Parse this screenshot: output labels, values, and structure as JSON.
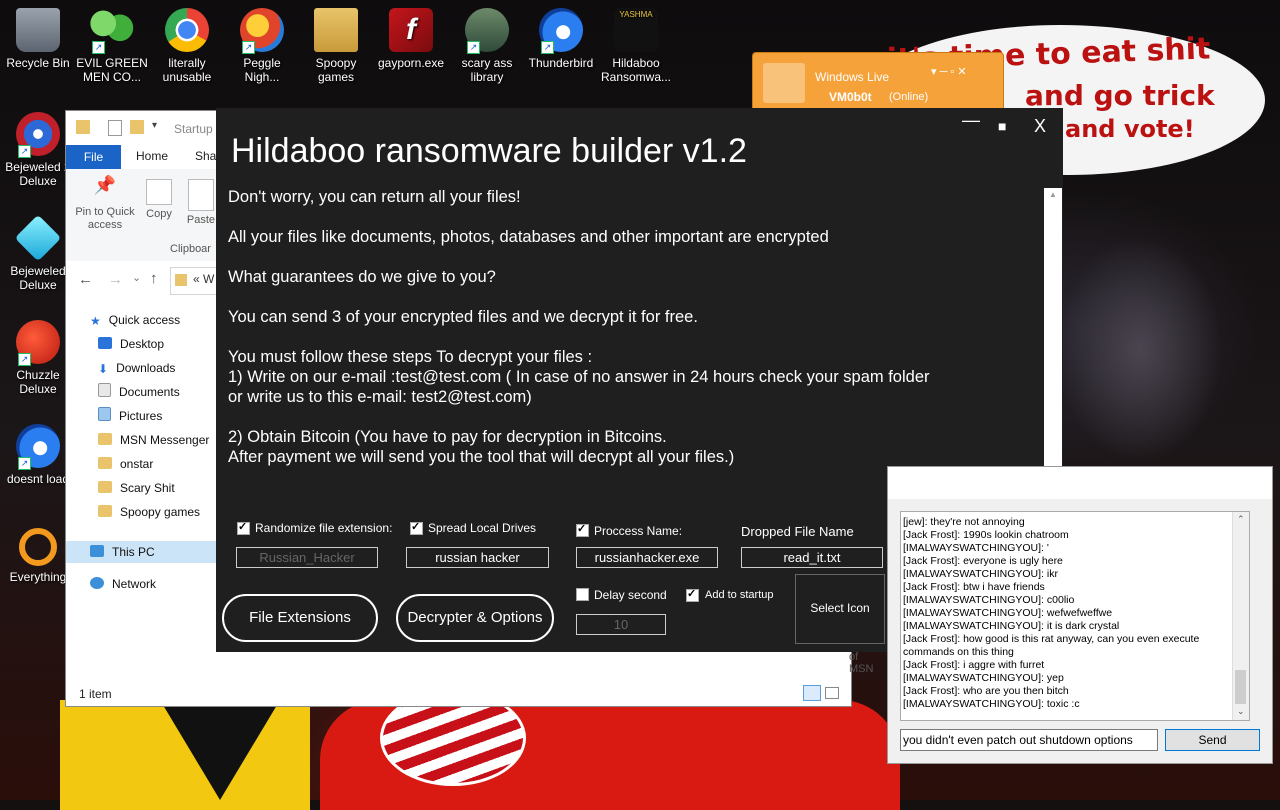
{
  "desktop": {
    "wallpaper_text": [
      "it's time to eat shit",
      "and go trick",
      "and vote!"
    ],
    "icons": [
      {
        "label": "Recycle Bin",
        "icon": "recycle-bin-icon"
      },
      {
        "label": "EVIL GREEN MEN CO...",
        "icon": "msn-people-icon"
      },
      {
        "label": "literally unusable",
        "icon": "chrome-icon"
      },
      {
        "label": "Peggle Nigh...",
        "icon": "peggle-icon"
      },
      {
        "label": "Spoopy games",
        "icon": "folder-icon"
      },
      {
        "label": "gayporn.exe",
        "icon": "flash-icon"
      },
      {
        "label": "scary ass library",
        "icon": "library-icon"
      },
      {
        "label": "Thunderbird",
        "icon": "thunderbird-icon"
      },
      {
        "label": "Hildaboo Ransomwa...",
        "icon": "yashma-icon"
      },
      {
        "label": "Bejeweled 2 Deluxe",
        "icon": "bejeweled2-icon"
      },
      {
        "label": "Bejeweled Deluxe",
        "icon": "bejeweled-icon"
      },
      {
        "label": "Chuzzle Deluxe",
        "icon": "chuzzle-icon"
      },
      {
        "label": "doesnt load",
        "icon": "thunderbird-icon"
      },
      {
        "label": "Everything",
        "icon": "everything-icon"
      }
    ],
    "icon_line2": [
      "",
      "MEN CO...",
      "unusable",
      "Nigh...",
      "games",
      "",
      "library",
      "",
      "Ransomwa...",
      "Deluxe",
      "Deluxe",
      "Deluxe",
      "",
      ""
    ],
    "icon_line1": [
      "Recycle Bin",
      "EVIL GREEN",
      "literally",
      "Peggle",
      "Spoopy",
      "gayporn.exe",
      "scary ass",
      "Thunderbird",
      "Hildaboo",
      "Bejeweled 2",
      "Bejeweled",
      "Chuzzle",
      "doesnt load",
      "Everything"
    ]
  },
  "explorer": {
    "title_crumb": "Startup",
    "tabs": {
      "file": "File",
      "home": "Home",
      "share": "Shar"
    },
    "ribbon": {
      "pin": "Pin to Quick access",
      "copy": "Copy",
      "paste": "Paste",
      "group": "Clipboar"
    },
    "address": "« W",
    "nav": {
      "quick_access": "Quick access",
      "items": [
        "Desktop",
        "Downloads",
        "Documents",
        "Pictures",
        "MSN Messenger",
        "onstar",
        "Scary Shit",
        "Spoopy games"
      ],
      "this_pc": "This PC",
      "network": "Network"
    },
    "status": "1 item",
    "partial_text": "of MSN"
  },
  "messenger": {
    "title": "Windows Live",
    "user": "VM0b0t",
    "status": "(Online)",
    "accent": "#f6a23a"
  },
  "builder": {
    "title": "Hildaboo ransomware builder v1.2",
    "window_controls": {
      "minimize": "—",
      "maximize": "■",
      "close": "X"
    },
    "message_lines": [
      "Don't worry, you can return all your files!",
      "All your files like documents, photos, databases and other important are encrypted",
      "What guarantees do we give to you?",
      "You can send 3 of your encrypted files and we decrypt it for free.",
      "You must follow these steps To decrypt your files :",
      "1) Write on our e-mail :test@test.com ( In case of no answer in 24 hours check your spam folder",
      "or write us to this e-mail: test2@test.com)",
      "2) Obtain Bitcoin (You have to pay for decryption in Bitcoins.",
      "After payment we will send you the tool that will decrypt all your files.)"
    ],
    "options": {
      "randomize_ext": {
        "label": "Randomize file extension:",
        "checked": true,
        "value": "Russian_Hacker"
      },
      "spread_drives": {
        "label": "Spread Local Drives",
        "checked": true,
        "value": "russian hacker"
      },
      "process_name": {
        "label": "Proccess Name:",
        "checked": true,
        "value": "russianhacker.exe"
      },
      "dropped_file": {
        "label": "Dropped File Name",
        "value": "read_it.txt"
      },
      "delay_second": {
        "label": "Delay second",
        "checked": false,
        "value": "10"
      },
      "add_startup": {
        "label": "Add to startup",
        "checked": true
      }
    },
    "buttons": {
      "file_extensions": "File Extensions",
      "decrypter": "Decrypter & Options",
      "select_icon": "Select Icon"
    }
  },
  "chat": {
    "messages": [
      "[jew]: they're not annoying",
      "[Jack Frost]: 1990s lookin chatroom",
      "[IMALWAYSWATCHINGYOU]: '",
      "[Jack Frost]: everyone is ugly here",
      "[IMALWAYSWATCHINGYOU]: ikr",
      "[Jack Frost]: btw i have friends",
      "[IMALWAYSWATCHINGYOU]: c00lio",
      "[IMALWAYSWATCHINGYOU]: wefwefweffwe",
      "[IMALWAYSWATCHINGYOU]: it is dark crystal",
      "[Jack Frost]: how good is this rat anyway, can you even execute",
      "commands on this thing",
      "[Jack Frost]: i aggre with furret",
      "[IMALWAYSWATCHINGYOU]: yep",
      "[Jack Frost]: who are you then bitch",
      "[IMALWAYSWATCHINGYOU]: toxic :c"
    ],
    "input_value": "you didn't even patch out shutdown options",
    "send_label": "Send"
  }
}
